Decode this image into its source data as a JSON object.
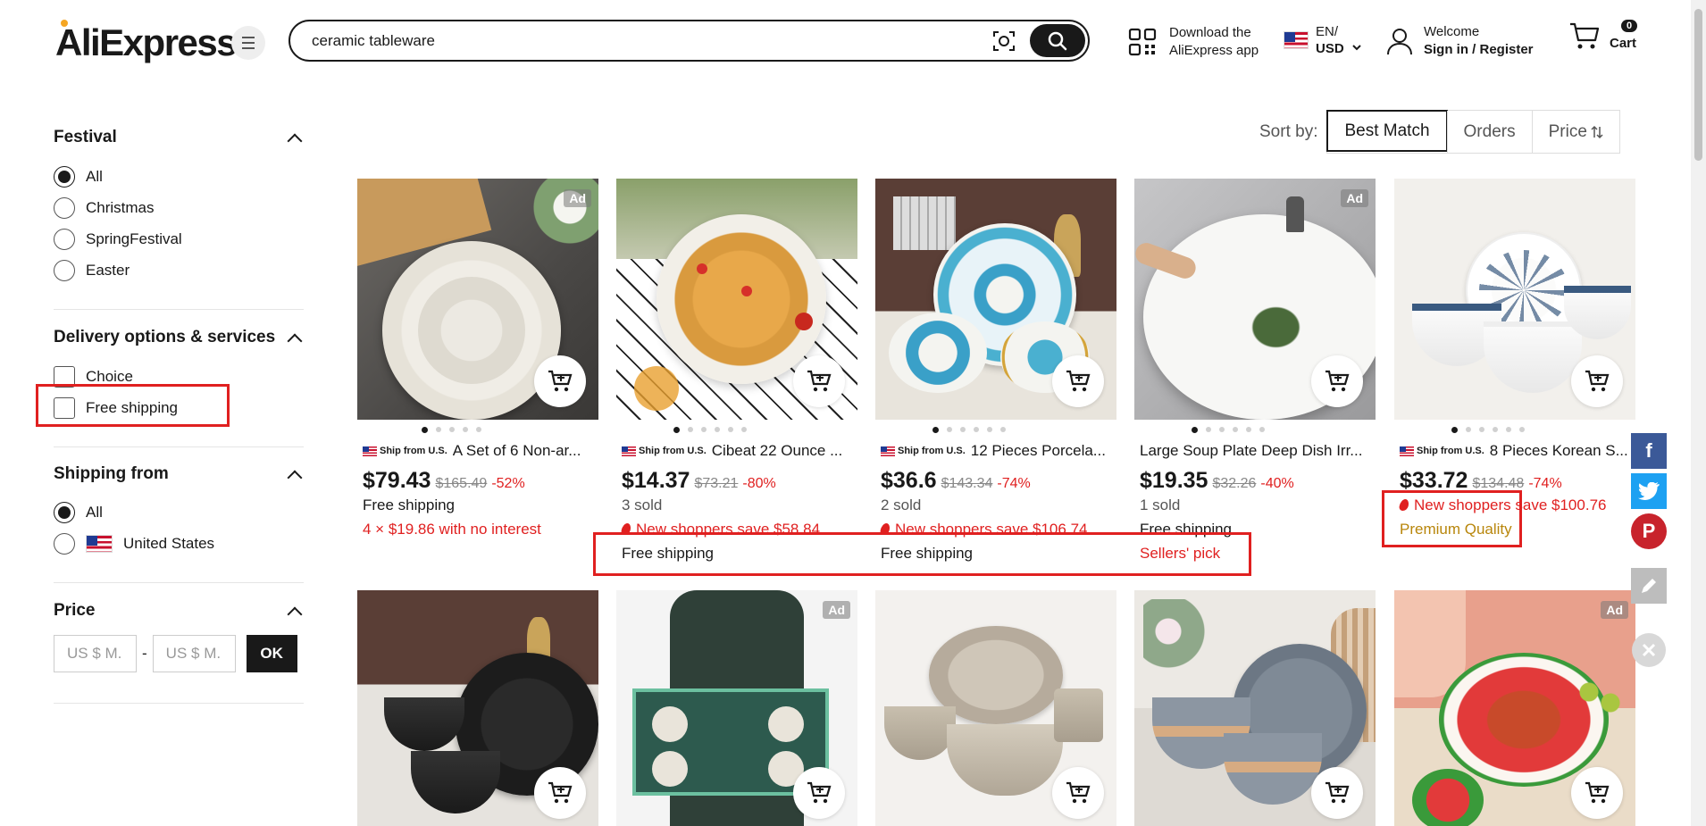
{
  "header": {
    "logo": "AliExpress",
    "search_value": "ceramic tableware",
    "app_download": [
      "Download the",
      "AliExpress app"
    ],
    "lang_top": "EN/",
    "lang_bottom": "USD",
    "account_top": "Welcome",
    "account_bottom": "Sign in / Register",
    "cart_count": "0",
    "cart_label": "Cart"
  },
  "sidebar": {
    "festival": {
      "title": "Festival",
      "options": [
        "All",
        "Christmas",
        "SpringFestival",
        "Easter"
      ],
      "selected": "All"
    },
    "delivery": {
      "title": "Delivery options & services",
      "options": [
        "Choice",
        "Free shipping"
      ]
    },
    "ship_from": {
      "title": "Shipping from",
      "options": [
        "All",
        "United States"
      ],
      "selected": "All"
    },
    "price": {
      "title": "Price",
      "min_placeholder": "US $ M.",
      "max_placeholder": "US $ M.",
      "separator": "-",
      "ok": "OK"
    }
  },
  "sort": {
    "label": "Sort by:",
    "options": [
      "Best Match",
      "Orders",
      "Price"
    ],
    "active": "Best Match"
  },
  "products": [
    {
      "ad": "Ad",
      "ship_from": "Ship from U.S.",
      "title": "A Set of 6 Non-ar...",
      "price": "$79.43",
      "old": "$165.49",
      "discount": "-52%",
      "l1": "Free shipping",
      "l2": "4 × $19.86 with no interest",
      "l3": ""
    },
    {
      "ad": "",
      "ship_from": "Ship from U.S.",
      "title": "Cibeat 22 Ounce ...",
      "price": "$14.37",
      "old": "$73.21",
      "discount": "-80%",
      "l1": "3 sold",
      "l2": "New shoppers save $58.84",
      "l3": "Free shipping"
    },
    {
      "ad": "",
      "ship_from": "Ship from U.S.",
      "title": "12 Pieces Porcela...",
      "price": "$36.6",
      "old": "$143.34",
      "discount": "-74%",
      "l1": "2 sold",
      "l2": "New shoppers save $106.74",
      "l3": "Free shipping"
    },
    {
      "ad": "Ad",
      "ship_from": "",
      "title": "Large Soup Plate Deep Dish Irr...",
      "price": "$19.35",
      "old": "$32.26",
      "discount": "-40%",
      "l1": "1 sold",
      "l2": "Free shipping",
      "l3": "Sellers' pick"
    },
    {
      "ad": "",
      "ship_from": "Ship from U.S.",
      "title": "8 Pieces Korean S...",
      "price": "$33.72",
      "old": "$134.48",
      "discount": "-74%",
      "l1": "New shoppers save $100.76",
      "l2": "Premium Quality",
      "l3": ""
    },
    {
      "ad": ""
    },
    {
      "ad": "Ad"
    },
    {
      "ad": ""
    },
    {
      "ad": ""
    },
    {
      "ad": "Ad"
    }
  ],
  "social": [
    "f",
    "t",
    "P"
  ]
}
